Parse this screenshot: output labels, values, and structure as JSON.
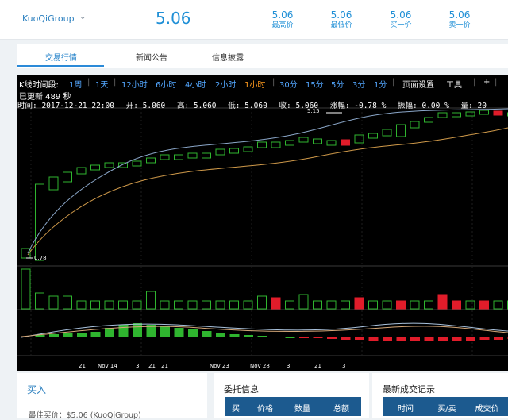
{
  "header": {
    "pair": "KuoQiGroup",
    "price": "5.06",
    "stats": [
      {
        "value": "5.06",
        "label": "最高价"
      },
      {
        "value": "5.06",
        "label": "最低价"
      },
      {
        "value": "5.06",
        "label": "买一价"
      },
      {
        "value": "5.06",
        "label": "卖一价"
      }
    ]
  },
  "tabs": [
    "交易行情",
    "新闻公告",
    "信息披露"
  ],
  "chart_toolbar": {
    "label": "K线时间段:",
    "periods": [
      "1周",
      "1天",
      "12小时",
      "6小时",
      "4小时",
      "2小时",
      "1小时",
      "30分",
      "15分",
      "5分",
      "3分",
      "1分"
    ],
    "selected": "1小时",
    "tools": [
      "页面设置",
      "工具"
    ],
    "updated": "已更新 489 秒"
  },
  "ohlc": {
    "time": "时间: 2017-12-21 22:00",
    "open": "开: 5.060",
    "high": "高: 5.060",
    "low": "低: 5.060",
    "close": "收: 5.060",
    "change": "涨幅: -0.78 %",
    "amplitude": "振幅: 0.00 %",
    "volume": "量: 20"
  },
  "chart_data": {
    "type": "candlestick",
    "max_label": "5.15",
    "min_label": "0.78",
    "x_ticks": [
      "21",
      "Nov 14",
      "3",
      "21",
      "21",
      "Nov 23",
      "Nov 28",
      "3",
      "21",
      "3"
    ],
    "colors": {
      "up": "#2fb52f",
      "down": "#e01c2a",
      "ma_short": "#8aa6c8",
      "ma_long": "#d09a4a"
    }
  },
  "panels": {
    "buy": {
      "title": "买入",
      "best_buy": "最佳买价：$5.06 (KuoQiGroup)"
    },
    "orders": {
      "title": "委托信息",
      "headers": [
        "买",
        "价格",
        "数量",
        "总额"
      ]
    },
    "trades": {
      "title": "最新成交记录",
      "headers": [
        "时间",
        "买/卖",
        "成交价"
      ]
    }
  }
}
